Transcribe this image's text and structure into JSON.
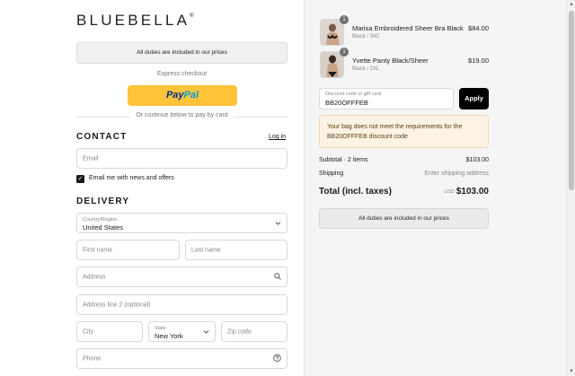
{
  "brand": {
    "name": "BLUEBELLA",
    "mark": "®"
  },
  "duties_notice": "All duties are included in our prices",
  "express_checkout": {
    "label": "Express checkout",
    "paypal_pay": "Pay",
    "paypal_pal": "Pal",
    "divider_text": "Or continue below to pay by card",
    "paypal_color": "#ffc439"
  },
  "contact": {
    "title": "CONTACT",
    "login_link": "Log in",
    "email_placeholder": "Email",
    "newsletter_label": "Email me with news and offers",
    "newsletter_checked": true
  },
  "delivery": {
    "title": "DELIVERY",
    "country_label": "Country/Region",
    "country_value": "United States",
    "first_name_placeholder": "First name",
    "last_name_placeholder": "Last name",
    "address_placeholder": "Address",
    "address2_placeholder": "Address line 2 (optional)",
    "city_placeholder": "City",
    "state_label": "State",
    "state_value": "New York",
    "zip_placeholder": "Zip code",
    "phone_placeholder": "Phone"
  },
  "order": {
    "items": [
      {
        "name": "Marisa Embroidered Sheer Bra Black",
        "variant": "Black / 34C",
        "price": "$84.00",
        "quantity": "1"
      },
      {
        "name": "Yvette Panty Black/Sheer",
        "variant": "Black / 2XL",
        "price": "$19.00",
        "quantity": "1"
      }
    ],
    "discount_label": "Discount code or gift card",
    "discount_value": "BB20OFFFEB",
    "apply_label": "Apply",
    "warning": "Your bag does not meet the requirements for the BB20OFFFEB discount code",
    "subtotal_label": "Subtotal · 2 items",
    "subtotal_value": "$103.00",
    "shipping_label": "Shipping",
    "shipping_value": "Enter shipping address",
    "total_label": "Total (incl. taxes)",
    "currency": "USD",
    "total_value": "$103.00",
    "duties_notice": "All duties are included in our prices"
  },
  "icons": {
    "search": "search-icon",
    "chevron": "chevron-down-icon",
    "help": "help-circle-icon",
    "check": "checkmark-icon"
  },
  "colors": {
    "warning_bg": "#fdf3e5",
    "apply_bg": "#000000",
    "summary_bg": "#f5f5f5"
  }
}
